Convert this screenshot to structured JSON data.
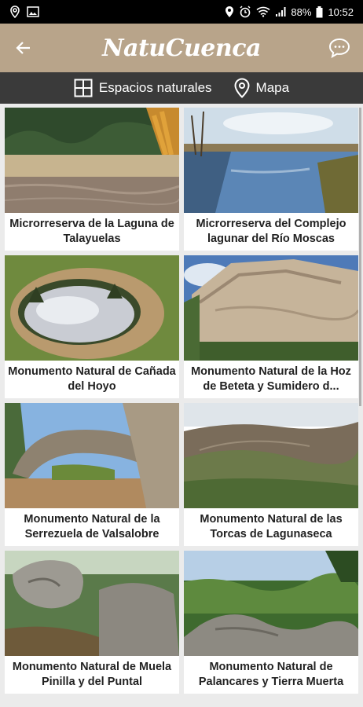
{
  "status_bar": {
    "battery": "88%",
    "time": "10:52"
  },
  "app_bar": {
    "title": "NatuCuenca"
  },
  "tabs": [
    {
      "label": "Espacios naturales"
    },
    {
      "label": "Mapa"
    }
  ],
  "cards": [
    {
      "title": "Microrreserva de la Laguna de Talayuelas"
    },
    {
      "title": "Microrreserva del Complejo lagunar del Río Moscas"
    },
    {
      "title": "Monumento Natural de Cañada del Hoyo"
    },
    {
      "title": "Monumento Natural de la Hoz de Beteta y Sumidero d..."
    },
    {
      "title": "Monumento Natural de la Serrezuela de Valsalobre"
    },
    {
      "title": "Monumento Natural de las Torcas de Lagunaseca"
    },
    {
      "title": "Monumento Natural de Muela Pinilla y del Puntal"
    },
    {
      "title": "Monumento Natural de Palancares y Tierra Muerta"
    }
  ]
}
